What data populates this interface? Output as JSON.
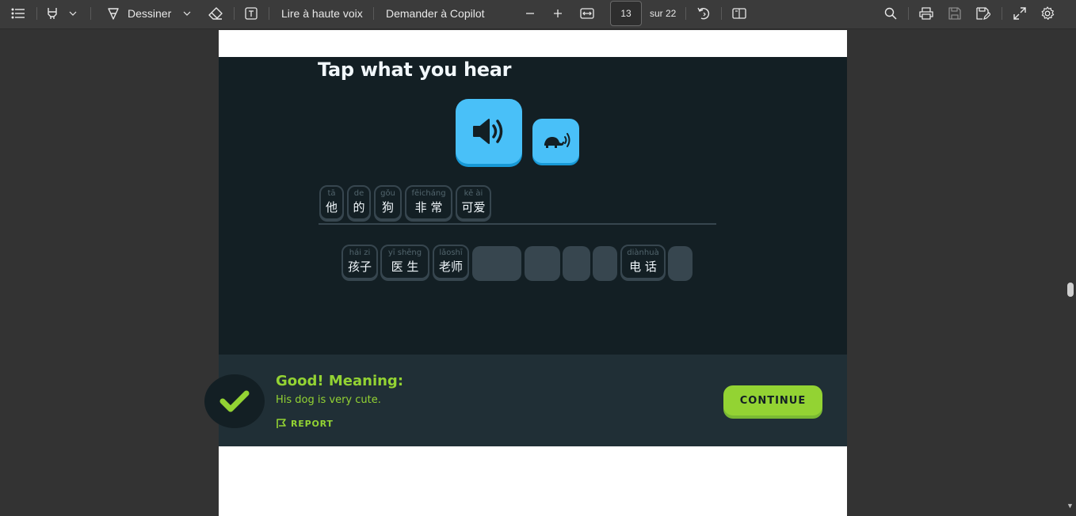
{
  "toolbar": {
    "draw_label": "Dessiner",
    "read_aloud_label": "Lire à haute voix",
    "copilot_label": "Demander à Copilot",
    "current_page": "13",
    "page_total": "sur 22"
  },
  "exercise": {
    "heading": "Tap what you hear",
    "answer_tiles": [
      {
        "pinyin": "tā",
        "hanzi": "他"
      },
      {
        "pinyin": "de",
        "hanzi": "的"
      },
      {
        "pinyin": "gǒu",
        "hanzi": "狗"
      },
      {
        "pinyin": "fēicháng",
        "hanzi": "非 常"
      },
      {
        "pinyin": "kě ài",
        "hanzi": "可爱"
      }
    ],
    "bank_tiles": [
      {
        "pinyin": "hái zi",
        "hanzi": "孩子"
      },
      {
        "pinyin": "yī shēng",
        "hanzi": "医 生"
      },
      {
        "pinyin": "lǎoshī",
        "hanzi": "老师"
      },
      {
        "pinyin": "diànhuà",
        "hanzi": "电 话"
      }
    ]
  },
  "feedback": {
    "title": "Good! Meaning:",
    "meaning": "His dog is very cute.",
    "report_label": "REPORT",
    "continue_label": "CONTINUE"
  },
  "colors": {
    "duo_bg": "#131f24",
    "feedback_bg": "#202f36",
    "accent_green": "#93d333",
    "speaker_blue": "#49c0f8"
  }
}
